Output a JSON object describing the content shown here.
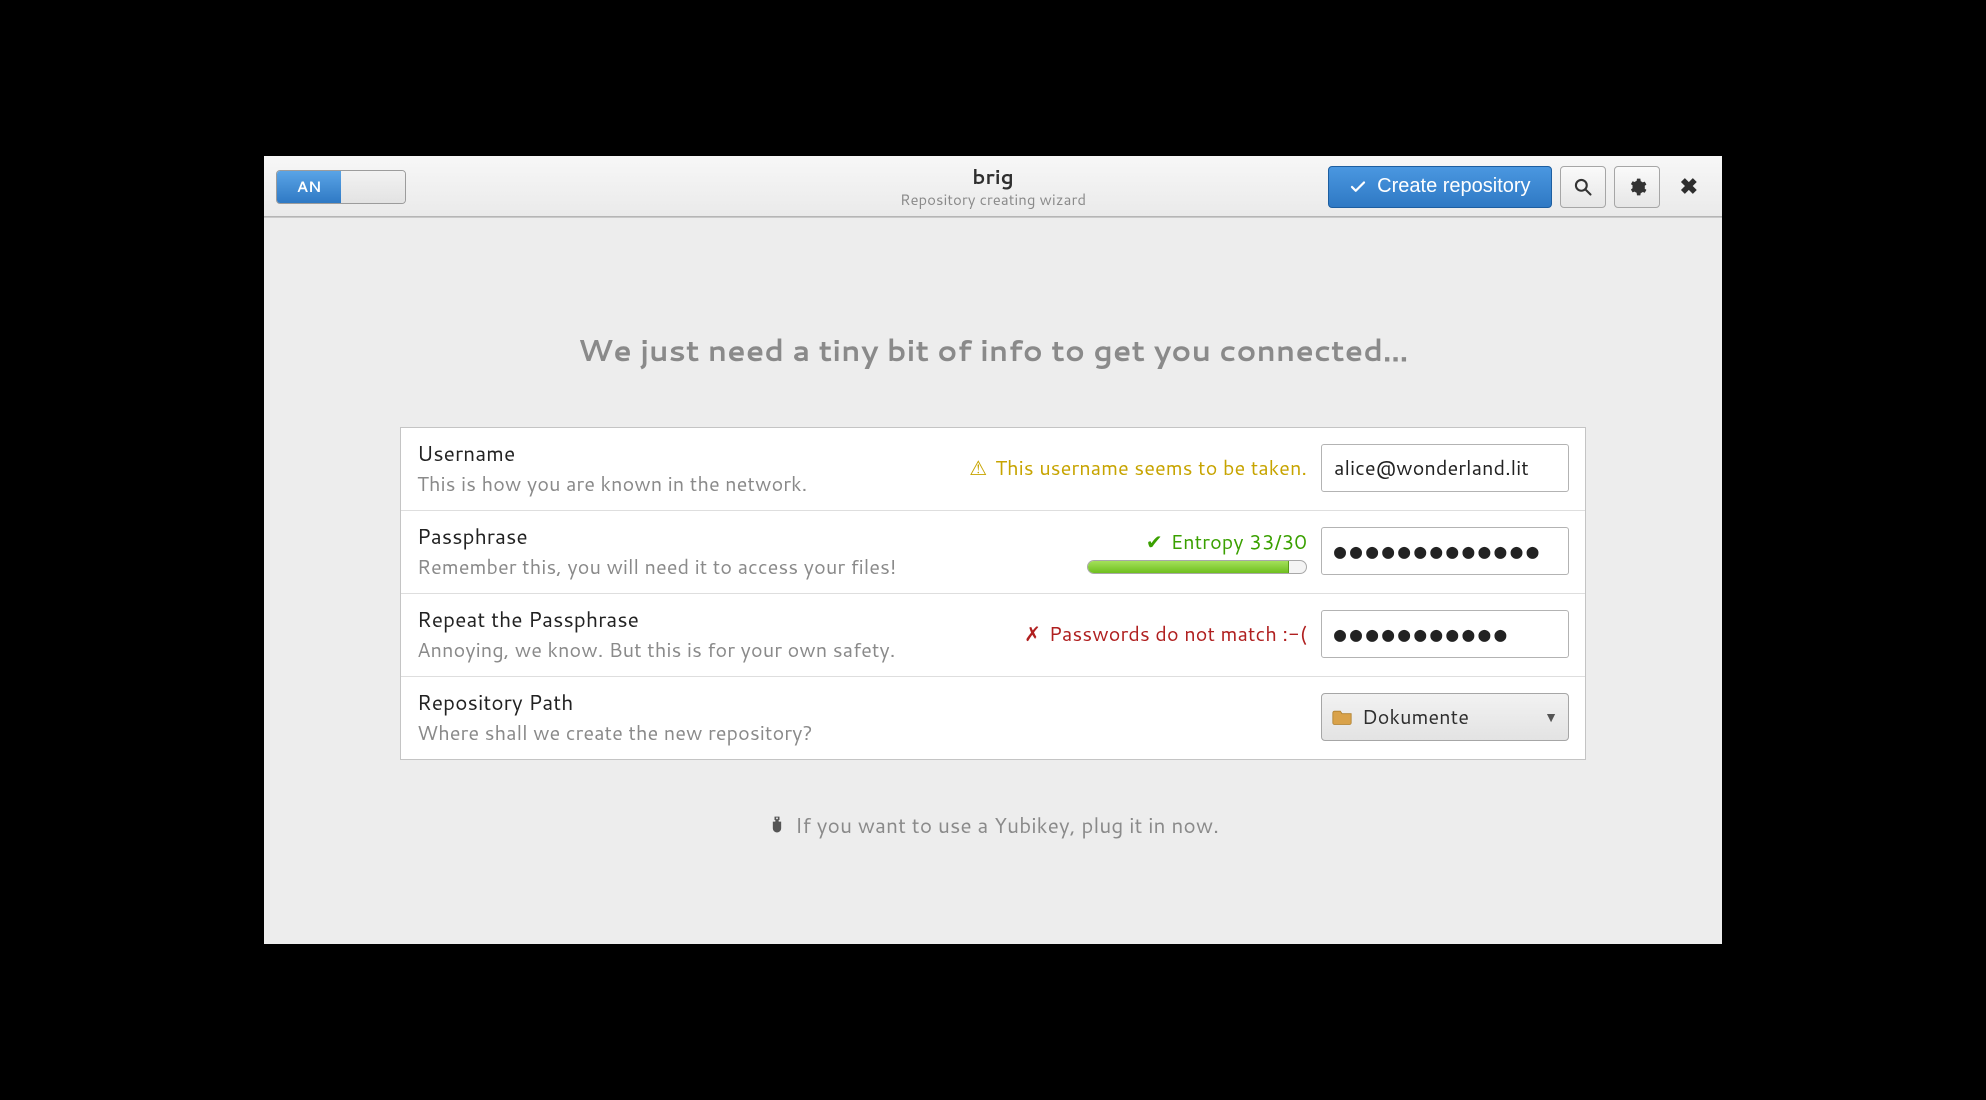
{
  "header": {
    "lang_code": "AN",
    "title": "brig",
    "subtitle": "Repository creating wizard",
    "create_button": "Create repository"
  },
  "headline": "We just need a tiny bit of info to get you connected...",
  "form": {
    "username": {
      "label": "Username",
      "desc": "This is how you are known in the network.",
      "status": "This username seems to be taken.",
      "value": "alice@wonderland.lit"
    },
    "passphrase": {
      "label": "Passphrase",
      "desc": "Remember this, you will need it to access your files!",
      "status": "Entropy 33/30",
      "progress_percent": 92,
      "value": "●●●●●●●●●●●●●"
    },
    "repeat": {
      "label": "Repeat the Passphrase",
      "desc": "Annoying, we know. But this is for your own safety.",
      "status": "Passwords do not match :-(",
      "value": "●●●●●●●●●●●"
    },
    "path": {
      "label": "Repository Path",
      "desc": "Where shall we create the new repository?",
      "selected": "Dokumente"
    }
  },
  "hint": "If you want to use a Yubikey, plug it in now."
}
